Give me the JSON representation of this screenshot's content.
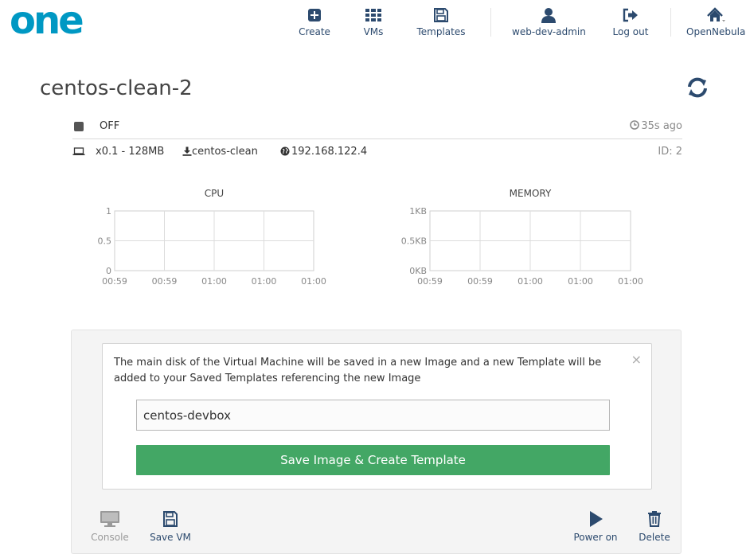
{
  "brand": {
    "logo_text": "one",
    "logo_color": "#0098c3"
  },
  "nav": {
    "create": "Create",
    "vms": "VMs",
    "templates": "Templates",
    "user": "web-dev-admin",
    "logout": "Log out",
    "zone": "OpenNebula"
  },
  "vm": {
    "name": "centos-clean-2",
    "state": "OFF",
    "last_update": "35s ago",
    "capacity": "x0.1 - 128MB",
    "template": "centos-clean",
    "ip": "192.168.122.4",
    "id": "ID: 2"
  },
  "charts": {
    "cpu": {
      "title": "CPU",
      "y_ticks": [
        "1",
        "0.5",
        "0"
      ],
      "x_ticks": [
        "00:59",
        "00:59",
        "01:00",
        "01:00",
        "01:00"
      ]
    },
    "memory": {
      "title": "MEMORY",
      "y_ticks": [
        "1KB",
        "0.5KB",
        "0KB"
      ],
      "x_ticks": [
        "00:59",
        "00:59",
        "01:00",
        "01:00",
        "01:00"
      ]
    }
  },
  "chart_data": [
    {
      "type": "line",
      "title": "CPU",
      "x": [
        "00:59",
        "00:59",
        "01:00",
        "01:00",
        "01:00"
      ],
      "series": [],
      "ylim": [
        0,
        1
      ],
      "grid": true
    },
    {
      "type": "line",
      "title": "MEMORY",
      "x": [
        "00:59",
        "00:59",
        "01:00",
        "01:00",
        "01:00"
      ],
      "series": [],
      "ylim": [
        0,
        1
      ],
      "y_unit": "KB",
      "grid": true
    }
  ],
  "save_dialog": {
    "message": "The main disk of the Virtual Machine will be saved in a new Image and a new Template will be added to your Saved Templates referencing the new Image",
    "close": "×",
    "name_value": "centos-devbox",
    "submit_label": "Save Image & Create Template"
  },
  "actions": {
    "console": "Console",
    "save_vm": "Save VM",
    "power_on": "Power on",
    "delete": "Delete"
  },
  "colors": {
    "nav_text": "#2c4a6e",
    "accent_green": "#43a765",
    "muted": "#8a8a8a"
  },
  "icons": [
    "plus-square-icon",
    "grid-icon",
    "floppy-icon",
    "user-icon",
    "logout-icon",
    "home-icon",
    "refresh-icon",
    "stop-icon",
    "clock-icon",
    "laptop-icon",
    "download-icon",
    "globe-icon",
    "monitor-icon",
    "play-icon",
    "trash-icon"
  ]
}
